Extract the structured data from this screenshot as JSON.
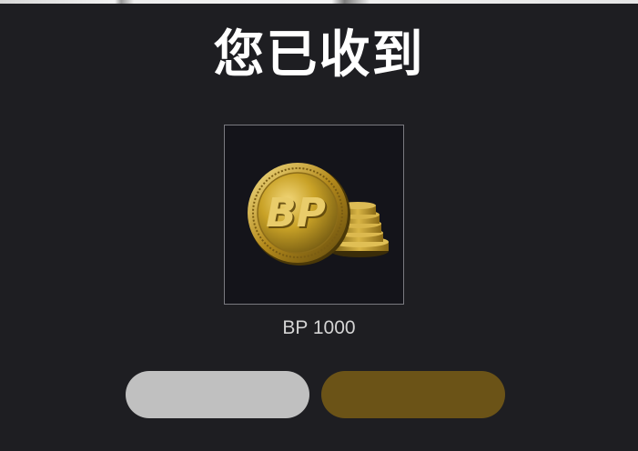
{
  "dialog": {
    "title": "您已收到",
    "reward": {
      "icon": "bp-coin-stack-icon",
      "label": "BP 1000"
    },
    "buttons": {
      "secondary_label": "",
      "primary_label": ""
    }
  },
  "colors": {
    "background": "#1e1e22",
    "secondary_button": "#c0c0c0",
    "primary_button": "#6b5317",
    "coin_gold": "#c9a227"
  }
}
